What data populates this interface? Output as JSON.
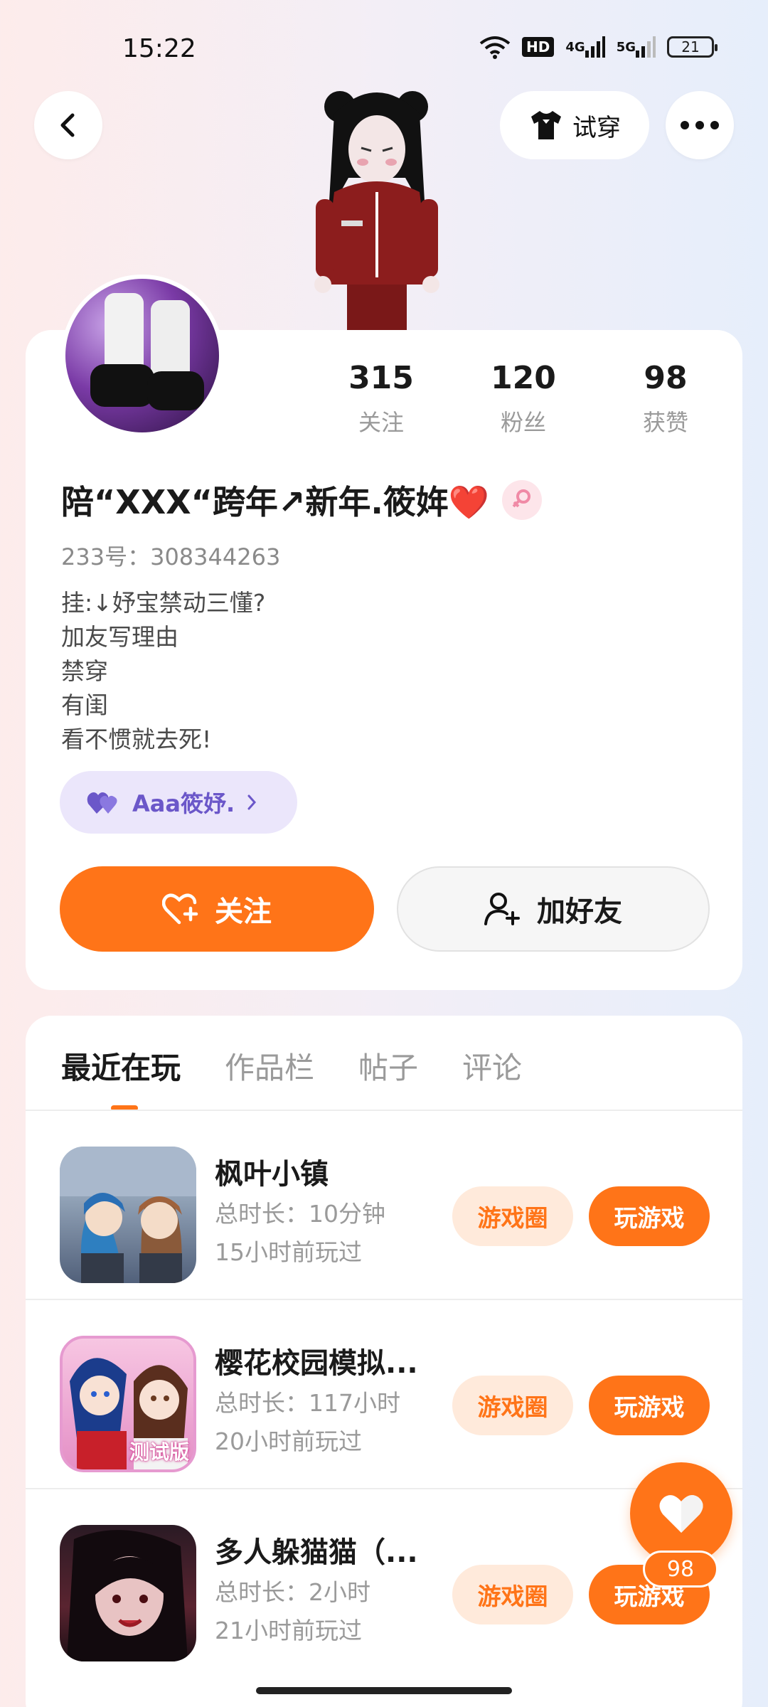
{
  "status_bar": {
    "time": "15:22",
    "network": "HD",
    "signal1": "4G",
    "signal2": "5G",
    "battery": "21"
  },
  "nav": {
    "try_on_label": "试穿"
  },
  "profile": {
    "stats": [
      {
        "value": "315",
        "label": "关注"
      },
      {
        "value": "120",
        "label": "粉丝"
      },
      {
        "value": "98",
        "label": "获赞"
      }
    ],
    "nickname": "陪“XXX“跨年↗新年.筱姩❤️",
    "uid": "233号：308344263",
    "bio": [
      "挂:↓妤宝禁动三懂?",
      "加友写理由",
      "禁穿",
      "有闺",
      "看不惯就去死!"
    ],
    "tag_chip": "Aaa筱妤.",
    "follow_label": "关注",
    "add_friend_label": "加好友"
  },
  "tabs": [
    "最近在玩",
    "作品栏",
    "帖子",
    "评论"
  ],
  "games": [
    {
      "name": "枫叶小镇",
      "duration": "总时长：10分钟",
      "last_played": "15小时前玩过",
      "circle_label": "游戏圈",
      "play_label": "玩游戏"
    },
    {
      "name": "樱花校园模拟...",
      "duration": "总时长：117小时",
      "last_played": "20小时前玩过",
      "circle_label": "游戏圈",
      "play_label": "玩游戏"
    },
    {
      "name": "多人躲猫猫（...",
      "duration": "总时长：2小时",
      "last_played": "21小时前玩过",
      "circle_label": "游戏圈",
      "play_label": "玩游戏"
    }
  ],
  "thumb_badge": "测试版",
  "like_count": "98",
  "colors": {
    "accent": "#ff7418",
    "accent_light": "#ffeadb",
    "chip": "#ebe6fb"
  }
}
